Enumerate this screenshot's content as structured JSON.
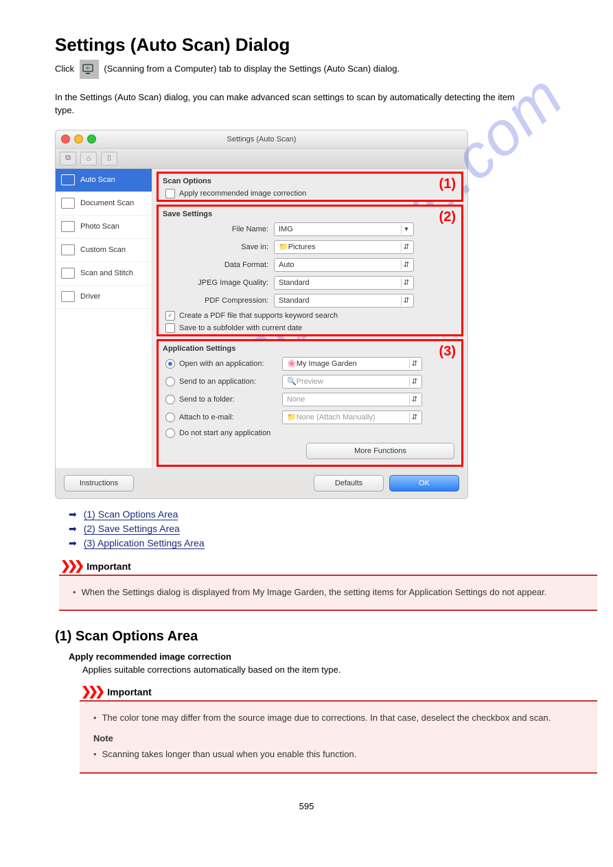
{
  "page": {
    "title": "Settings (Auto Scan) Dialog",
    "intro_before": "Click ",
    "intro_after": " (Scanning from a Computer) tab to display the Settings (Auto Scan) dialog.",
    "after_intro": "In the Settings (Auto Scan) dialog, you can make advanced scan settings to scan by automatically detecting the item type.",
    "watermark": "manualshive.com",
    "pagenum": "595"
  },
  "dialog": {
    "title": "Settings (Auto Scan)",
    "sidebar": [
      "Auto Scan",
      "Document Scan",
      "Photo Scan",
      "Custom Scan",
      "Scan and Stitch",
      "Driver"
    ],
    "section1": {
      "h": "Scan Options",
      "badge": "(1)",
      "chk_label": "Apply recommended image correction"
    },
    "section2": {
      "h": "Save Settings",
      "badge": "(2)",
      "file_name_lab": "File Name:",
      "file_name_val": "IMG",
      "save_in_lab": "Save in:",
      "save_in_val": "Pictures",
      "data_fmt_lab": "Data Format:",
      "data_fmt_val": "Auto",
      "jpeg_lab": "JPEG Image Quality:",
      "jpeg_val": "Standard",
      "pdf_lab": "PDF Compression:",
      "pdf_val": "Standard",
      "kw_label": "Create a PDF file that supports keyword search",
      "sub_label": "Save to a subfolder with current date"
    },
    "section3": {
      "h": "Application Settings",
      "badge": "(3)",
      "r1": "Open with an application:",
      "r1_val": "My Image Garden",
      "r2": "Send to an application:",
      "r2_val": "Preview",
      "r3": "Send to a folder:",
      "r3_val": "None",
      "r4": "Attach to e-mail:",
      "r4_val": "None (Attach Manually)",
      "r5": "Do not start any application",
      "more": "More Functions"
    },
    "foot": {
      "instructions": "Instructions",
      "defaults": "Defaults",
      "ok": "OK"
    }
  },
  "links": {
    "l1": "(1) Scan Options Area",
    "l2": "(2) Save Settings Area",
    "l3": "(3) Application Settings Area"
  },
  "important": {
    "label": "Important",
    "text": "When the Settings dialog is displayed from My Image Garden, the setting items for Application Settings do not appear."
  },
  "scan_options": {
    "h": "(1) Scan Options Area",
    "item_h": "Apply recommended image correction",
    "item_body": "Applies suitable corrections automatically based on the item type."
  },
  "important2": {
    "label": "Important",
    "b1": "The color tone may differ from the source image due to corrections. In that case, deselect the checkbox and scan.",
    "note_label": "Note",
    "b2": "Scanning takes longer than usual when you enable this function."
  }
}
